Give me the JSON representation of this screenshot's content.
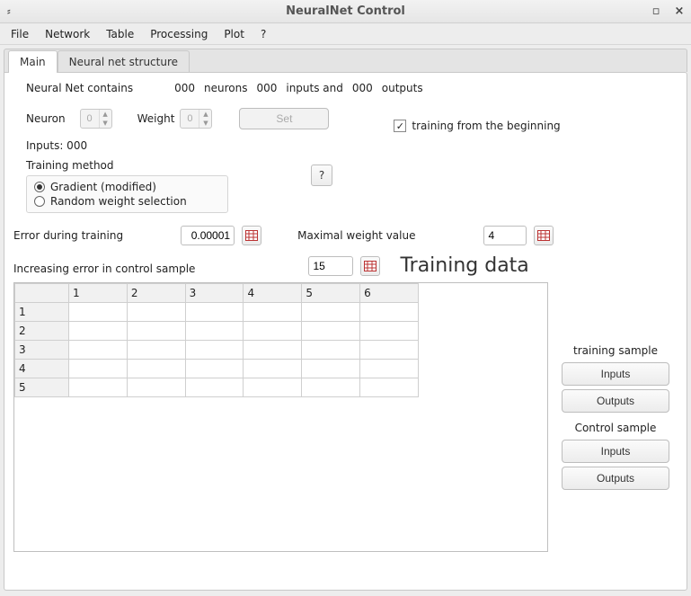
{
  "window": {
    "title": "NeuralNet Control"
  },
  "menu": {
    "file": "File",
    "network": "Network",
    "table": "Table",
    "processing": "Processing",
    "plot": "Plot",
    "help": "?"
  },
  "tabs": {
    "main": "Main",
    "structure": "Neural net structure"
  },
  "main": {
    "nn_contains_prefix": "Neural Net contains",
    "nn_neurons_count": "000",
    "nn_neurons_word": "neurons",
    "nn_inputs_count": "000",
    "nn_inputs_word": "inputs and",
    "nn_outputs_count": "000",
    "nn_outputs_word": "outputs",
    "neuron_label": "Neuron",
    "neuron_value": "0",
    "weight_label": "Weight",
    "weight_value": "0",
    "set_button": "Set",
    "training_begin_label": "training from the beginning",
    "training_begin_checked": true,
    "inputs_line": "Inputs: 000",
    "training_method_label": "Training method",
    "radio_gradient": "Gradient (modified)",
    "radio_random": "Random weight selection",
    "help_q": "?",
    "error_training_label": "Error during training",
    "error_training_value": "0.00001",
    "max_weight_label": "Maximal weight value",
    "max_weight_value": "4",
    "inc_error_label": "Increasing error in control sample",
    "inc_error_value": "15",
    "training_data_heading": "Training data",
    "table": {
      "col_headers": [
        "1",
        "2",
        "3",
        "4",
        "5",
        "6"
      ],
      "row_headers": [
        "1",
        "2",
        "3",
        "4",
        "5"
      ]
    },
    "side": {
      "training_sample": "training sample",
      "inputs": "Inputs",
      "outputs": "Outputs",
      "control_sample": "Control sample"
    }
  }
}
